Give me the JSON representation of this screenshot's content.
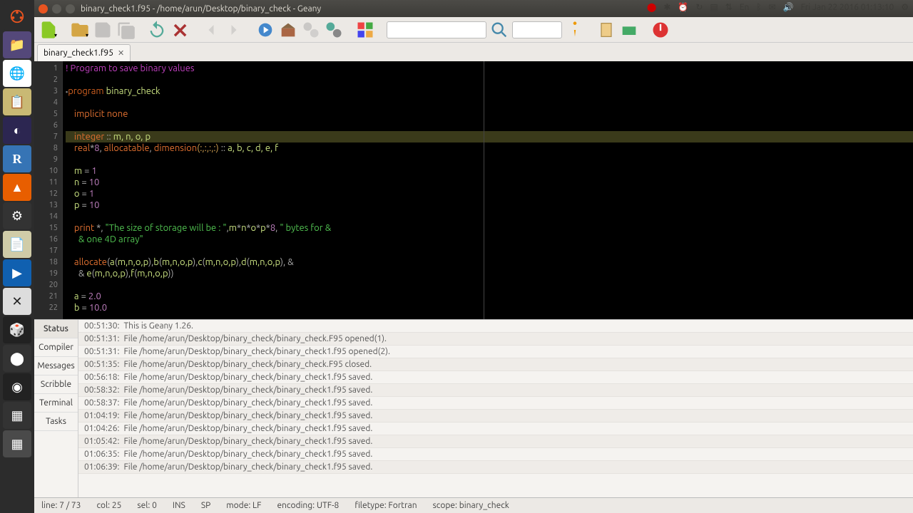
{
  "window": {
    "title": "binary_check1.f95 - /home/arun/Desktop/binary_check - Geany"
  },
  "systray": {
    "clock": "Fri Jan 22 2016 01:13:10"
  },
  "tab": {
    "filename": "binary_check1.f95"
  },
  "code": {
    "lines": [
      {
        "n": "1",
        "html": "<span class='c-comment'>! Program to save binary values</span>"
      },
      {
        "n": "2",
        "html": ""
      },
      {
        "n": "3",
        "html": "<span class='fold'>▪</span><span class='c-keyword'>program</span> <span class='c-ident'>binary_check</span>"
      },
      {
        "n": "4",
        "html": ""
      },
      {
        "n": "5",
        "html": "    <span class='c-keyword2'>implicit none</span>"
      },
      {
        "n": "6",
        "html": ""
      },
      {
        "n": "7",
        "hl": true,
        "html": "    <span class='c-keyword2'>integer</span> <span class='c-op'>::</span> <span class='c-ident'>m, n, o, p</span>"
      },
      {
        "n": "8",
        "html": "    <span class='c-keyword2'>real</span><span class='c-op'>*</span><span class='c-num'>8</span><span class='c-op'>,</span> <span class='c-keyword2'>allocatable</span><span class='c-op'>,</span> <span class='c-keyword2'>dimension</span><span class='c-dim'>(:,:,:,:)</span> <span class='c-op'>::</span> <span class='c-ident'>a, b, c, d, e, f</span>"
      },
      {
        "n": "9",
        "html": ""
      },
      {
        "n": "10",
        "html": "    <span class='c-ident'>m</span> <span class='c-op'>=</span> <span class='c-num'>1</span>"
      },
      {
        "n": "11",
        "html": "    <span class='c-ident'>n</span> <span class='c-op'>=</span> <span class='c-num'>10</span>"
      },
      {
        "n": "12",
        "html": "    <span class='c-ident'>o</span> <span class='c-op'>=</span> <span class='c-num'>1</span>"
      },
      {
        "n": "13",
        "html": "    <span class='c-ident'>p</span> <span class='c-op'>=</span> <span class='c-num'>10</span>"
      },
      {
        "n": "14",
        "html": ""
      },
      {
        "n": "15",
        "html": "    <span class='c-keyword2'>print</span> <span class='c-op'>*,</span> <span class='c-str'>\"The size of storage will be : \"</span><span class='c-op'>,</span><span class='c-ident'>m</span><span class='c-op'>*</span><span class='c-ident'>n</span><span class='c-op'>*</span><span class='c-ident'>o</span><span class='c-op'>*</span><span class='c-ident'>p</span><span class='c-op'>*</span><span class='c-num'>8</span><span class='c-op'>,</span> <span class='c-str'>\" bytes for &amp;</span>"
      },
      {
        "n": "16",
        "html": "    <span class='c-str'>  &amp; one 4D array\"</span>"
      },
      {
        "n": "17",
        "html": ""
      },
      {
        "n": "18",
        "html": "    <span class='c-keyword2'>allocate</span><span class='c-op'>(</span><span class='c-ident'>a</span><span class='c-op'>(</span><span class='c-ident'>m,n,o,p</span><span class='c-op'>),</span><span class='c-ident'>b</span><span class='c-op'>(</span><span class='c-ident'>m,n,o,p</span><span class='c-op'>),</span><span class='c-ident'>c</span><span class='c-op'>(</span><span class='c-ident'>m,n,o,p</span><span class='c-op'>),</span><span class='c-ident'>d</span><span class='c-op'>(</span><span class='c-ident'>m,n,o,p</span><span class='c-op'>), &amp;</span>"
      },
      {
        "n": "19",
        "html": "      <span class='c-op'>&amp;</span> <span class='c-ident'>e</span><span class='c-op'>(</span><span class='c-ident'>m,n,o,p</span><span class='c-op'>),</span><span class='c-ident'>f</span><span class='c-op'>(</span><span class='c-ident'>m,n,o,p</span><span class='c-op'>))</span>"
      },
      {
        "n": "20",
        "html": ""
      },
      {
        "n": "21",
        "html": "    <span class='c-ident'>a</span> <span class='c-op'>=</span> <span class='c-num'>2.0</span>"
      },
      {
        "n": "22",
        "html": "    <span class='c-ident'>b</span> <span class='c-op'>=</span> <span class='c-num'>10.0</span>"
      }
    ]
  },
  "panel": {
    "tabs": [
      "Status",
      "Compiler",
      "Messages",
      "Scribble",
      "Terminal",
      "Tasks"
    ],
    "messages": [
      {
        "t": "00:51:30:",
        "m": "This is Geany 1.26."
      },
      {
        "t": "00:51:31:",
        "m": "File /home/arun/Desktop/binary_check/binary_check.F95 opened(1)."
      },
      {
        "t": "00:51:31:",
        "m": "File /home/arun/Desktop/binary_check/binary_check1.f95 opened(2)."
      },
      {
        "t": "00:51:35:",
        "m": "File /home/arun/Desktop/binary_check/binary_check.F95 closed."
      },
      {
        "t": "00:56:18:",
        "m": "File /home/arun/Desktop/binary_check/binary_check1.f95 saved."
      },
      {
        "t": "00:58:32:",
        "m": "File /home/arun/Desktop/binary_check/binary_check1.f95 saved."
      },
      {
        "t": "00:58:37:",
        "m": "File /home/arun/Desktop/binary_check/binary_check1.f95 saved."
      },
      {
        "t": "01:04:19:",
        "m": "File /home/arun/Desktop/binary_check/binary_check1.f95 saved."
      },
      {
        "t": "01:04:26:",
        "m": "File /home/arun/Desktop/binary_check/binary_check1.f95 saved."
      },
      {
        "t": "01:05:42:",
        "m": "File /home/arun/Desktop/binary_check/binary_check1.f95 saved."
      },
      {
        "t": "01:06:35:",
        "m": "File /home/arun/Desktop/binary_check/binary_check1.f95 saved."
      },
      {
        "t": "01:06:39:",
        "m": "File /home/arun/Desktop/binary_check/binary_check1.f95 saved."
      }
    ]
  },
  "status": {
    "line": "line: 7 / 73",
    "col": "col: 25",
    "sel": "sel: 0",
    "ins": "INS",
    "sp": "SP",
    "mode": "mode: LF",
    "encoding": "encoding: UTF-8",
    "filetype": "filetype: Fortran",
    "scope": "scope: binary_check"
  }
}
